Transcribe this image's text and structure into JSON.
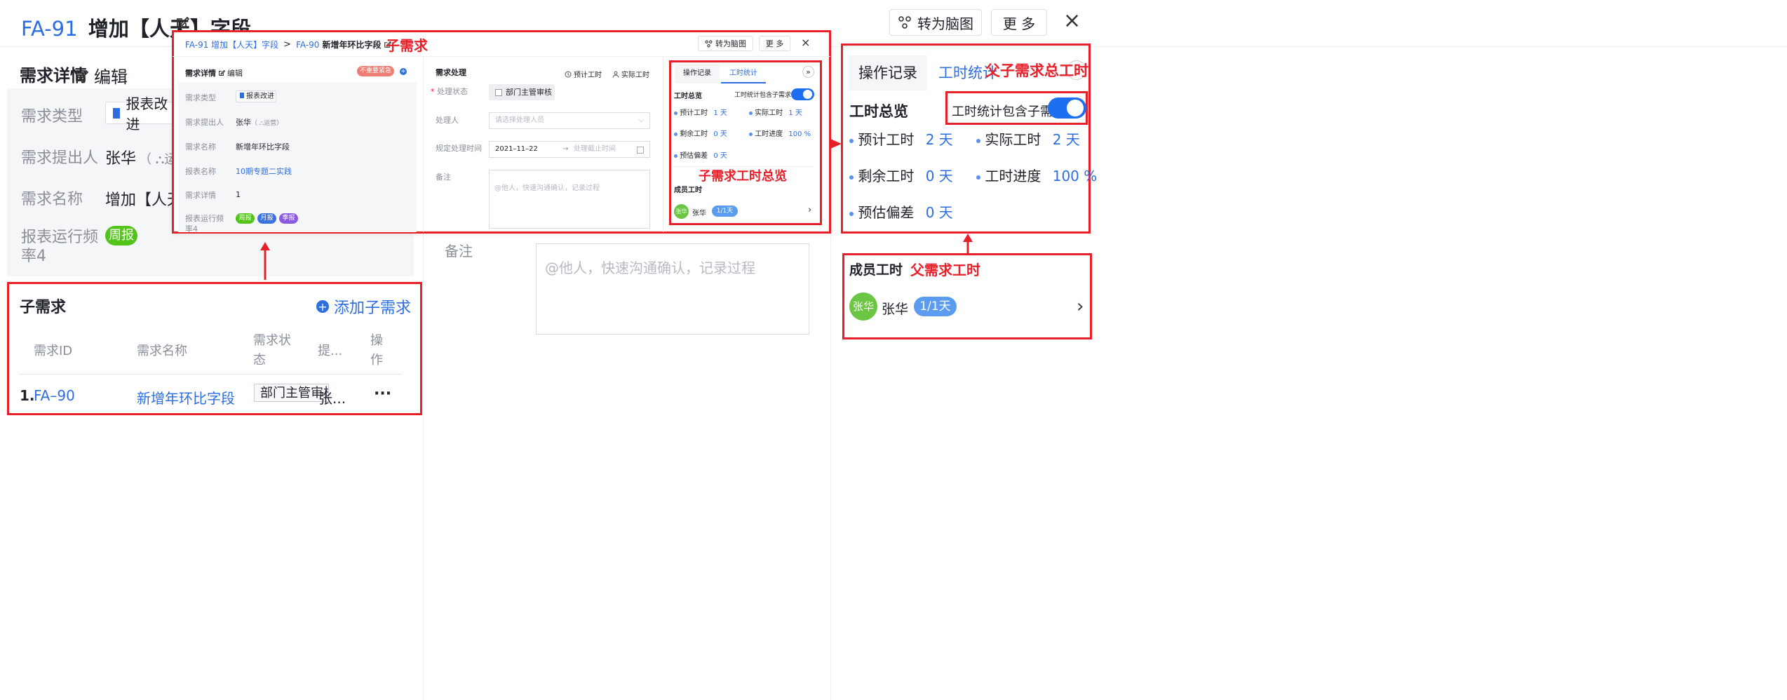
{
  "header": {
    "id": "FA-91",
    "title": "增加【人天】字段",
    "mindmap_label": "转为脑图",
    "more_label": "更 多",
    "close": "×"
  },
  "left": {
    "section_title": "需求详情",
    "edit_label": "编辑",
    "fields": [
      {
        "label": "需求类型",
        "value": "报表改进"
      },
      {
        "label": "需求提出人",
        "value": "张华",
        "sub": "（ ⛬运营"
      },
      {
        "label": "需求名称",
        "value": "增加【人天】"
      },
      {
        "label": "报表运行频",
        "label2": "率4",
        "value": "周报"
      }
    ],
    "remark_label": "备注",
    "remark_placeholder": "@他人，快速沟通确认，记录过程"
  },
  "subreq": {
    "title": "子需求",
    "add_label": "添加子需求",
    "columns": [
      "需求ID",
      "需求名称",
      "需求状",
      "态",
      "提...",
      "操",
      "作"
    ],
    "row": {
      "index": "1.",
      "id": "FA–90",
      "name": "新增年环比字段",
      "status": "部门主管审核",
      "proposer": "张...",
      "op": "···"
    }
  },
  "child_popup": {
    "crumb_parent": "FA-91 增加【人天】字段",
    "crumb_sep": ">",
    "crumb_id": "FA-90",
    "crumb_title": "新增年环比字段",
    "mindmap_label": "转为脑图",
    "more_label": "更 多",
    "close": "×",
    "detail_title": "需求详情",
    "edit_label": "编辑",
    "priority_tag": "不重要紧急",
    "fields": [
      {
        "label": "需求类型",
        "value": "报表改进"
      },
      {
        "label": "需求提出人",
        "value": "张华",
        "sub": "（ ⛬运营）"
      },
      {
        "label": "需求名称",
        "value": "新增年环比字段"
      },
      {
        "label": "报表名称",
        "value": "10期专题二实践"
      },
      {
        "label": "需求详情",
        "value": "1"
      },
      {
        "label": "报表运行频",
        "label2": "率4"
      }
    ],
    "freq_tags": [
      "周报",
      "月报",
      "季报"
    ],
    "process_title": "需求处理",
    "est_label": "预计工时",
    "act_label": "实际工时",
    "status_label": "处理状态",
    "status_value": "部门主管审核",
    "handler_label": "处理人",
    "handler_placeholder": "请选择处理人员",
    "deadline_label": "规定处理时间",
    "deadline_start": "2021–11–22",
    "deadline_arrow": "→",
    "deadline_end_placeholder": "处理截止时间",
    "remark_label": "备注",
    "remark_placeholder": "@他人，快速沟通确认，记录过程",
    "tabs": [
      "操作记录",
      "工时统计"
    ],
    "overview_title": "工时总览",
    "include_label": "工时统计包含子需求",
    "stats": [
      {
        "label": "预计工时",
        "value": "1 天"
      },
      {
        "label": "实际工时",
        "value": "1 天"
      },
      {
        "label": "剩余工时",
        "value": "0 天"
      },
      {
        "label": "工时进度",
        "value": "100 %"
      },
      {
        "label": "预估偏差",
        "value": "0 天"
      }
    ],
    "member_title": "成员工时",
    "member_avatar": "张华",
    "member_name": "张华",
    "member_hours": "1/1天"
  },
  "right": {
    "tabs": [
      "操作记录",
      "工时统计"
    ],
    "overview_title": "工时总览",
    "include_label": "工时统计包含子需求",
    "stats": [
      {
        "label": "预计工时",
        "value": "2 天"
      },
      {
        "label": "实际工时",
        "value": "2 天"
      },
      {
        "label": "剩余工时",
        "value": "0 天"
      },
      {
        "label": "工时进度",
        "value": "100 %"
      },
      {
        "label": "预估偏差",
        "value": "0 天"
      }
    ],
    "member_title": "成员工时",
    "member_avatar": "张华",
    "member_name": "张华",
    "member_hours": "1/1天"
  },
  "annotations": {
    "child": "子需求",
    "child_overview": "子需求工时总览",
    "parent_total": "父子需求总工时",
    "parent_member": "父需求工时"
  },
  "colors": {
    "accent": "#2d6ee0",
    "annotation": "#e8202a",
    "green_tag": "#52c41a",
    "toggle": "#1e6ff0"
  }
}
